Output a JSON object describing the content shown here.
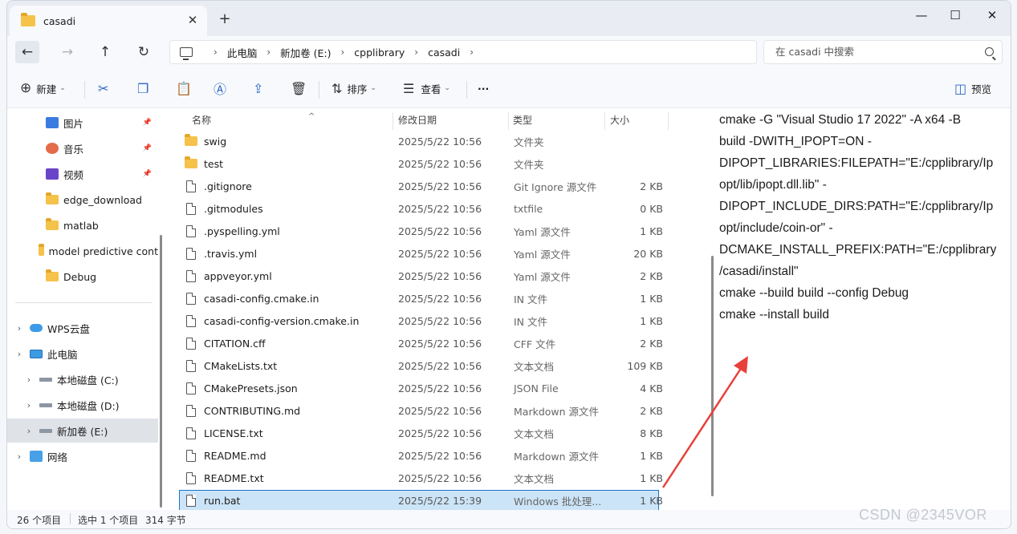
{
  "window": {
    "tab_title": "casadi",
    "new_tab": "+",
    "minimize": "—",
    "maximize": "☐",
    "close": "✕"
  },
  "nav": {
    "back": "←",
    "forward": "→",
    "up": "↑",
    "refresh": "↻"
  },
  "address": {
    "crumbs": [
      "此电脑",
      "新加卷 (E:)",
      "cpplibrary",
      "casadi"
    ],
    "separator": "›"
  },
  "search": {
    "placeholder": "在 casadi 中搜索"
  },
  "toolbar": {
    "new_label": "新建",
    "sort_label": "排序",
    "view_label": "查看",
    "more_label": "···",
    "preview_label": "预览"
  },
  "sidebar": {
    "items": [
      {
        "label": "图片",
        "icon": "pictures-icon",
        "pinned": true
      },
      {
        "label": "音乐",
        "icon": "music-icon",
        "pinned": true
      },
      {
        "label": "视频",
        "icon": "video-icon",
        "pinned": true
      },
      {
        "label": "edge_download",
        "icon": "folder-icon",
        "pinned": false
      },
      {
        "label": "matlab",
        "icon": "folder-icon",
        "pinned": false
      },
      {
        "label": "model predictive cont",
        "icon": "folder-icon",
        "pinned": false
      },
      {
        "label": "Debug",
        "icon": "folder-icon",
        "pinned": false
      },
      {
        "label": "WPS云盘",
        "icon": "cloud-icon",
        "pinned": false
      },
      {
        "label": "此电脑",
        "icon": "computer-icon",
        "pinned": false
      },
      {
        "label": "本地磁盘 (C:)",
        "icon": "drive-icon",
        "pinned": false
      },
      {
        "label": "本地磁盘 (D:)",
        "icon": "drive-icon",
        "pinned": false
      },
      {
        "label": "新加卷 (E:)",
        "icon": "drive-icon",
        "pinned": false
      },
      {
        "label": "网络",
        "icon": "network-icon",
        "pinned": false
      }
    ]
  },
  "columns": {
    "name": "名称",
    "date": "修改日期",
    "type": "类型",
    "size": "大小"
  },
  "files": [
    {
      "name": "swig",
      "date": "2025/5/22 10:56",
      "type": "文件夹",
      "size": "",
      "kind": "folder"
    },
    {
      "name": "test",
      "date": "2025/5/22 10:56",
      "type": "文件夹",
      "size": "",
      "kind": "folder"
    },
    {
      "name": ".gitignore",
      "date": "2025/5/22 10:56",
      "type": "Git Ignore 源文件",
      "size": "2 KB",
      "kind": "file"
    },
    {
      "name": ".gitmodules",
      "date": "2025/5/22 10:56",
      "type": "txtfile",
      "size": "0 KB",
      "kind": "file"
    },
    {
      "name": ".pyspelling.yml",
      "date": "2025/5/22 10:56",
      "type": "Yaml 源文件",
      "size": "1 KB",
      "kind": "file"
    },
    {
      "name": ".travis.yml",
      "date": "2025/5/22 10:56",
      "type": "Yaml 源文件",
      "size": "20 KB",
      "kind": "file"
    },
    {
      "name": "appveyor.yml",
      "date": "2025/5/22 10:56",
      "type": "Yaml 源文件",
      "size": "2 KB",
      "kind": "file"
    },
    {
      "name": "casadi-config.cmake.in",
      "date": "2025/5/22 10:56",
      "type": "IN 文件",
      "size": "1 KB",
      "kind": "file"
    },
    {
      "name": "casadi-config-version.cmake.in",
      "date": "2025/5/22 10:56",
      "type": "IN 文件",
      "size": "1 KB",
      "kind": "file"
    },
    {
      "name": "CITATION.cff",
      "date": "2025/5/22 10:56",
      "type": "CFF 文件",
      "size": "2 KB",
      "kind": "file"
    },
    {
      "name": "CMakeLists.txt",
      "date": "2025/5/22 10:56",
      "type": "文本文档",
      "size": "109 KB",
      "kind": "file"
    },
    {
      "name": "CMakePresets.json",
      "date": "2025/5/22 10:56",
      "type": "JSON File",
      "size": "4 KB",
      "kind": "file"
    },
    {
      "name": "CONTRIBUTING.md",
      "date": "2025/5/22 10:56",
      "type": "Markdown 源文件",
      "size": "2 KB",
      "kind": "file"
    },
    {
      "name": "LICENSE.txt",
      "date": "2025/5/22 10:56",
      "type": "文本文档",
      "size": "8 KB",
      "kind": "file"
    },
    {
      "name": "README.md",
      "date": "2025/5/22 10:56",
      "type": "Markdown 源文件",
      "size": "1 KB",
      "kind": "file"
    },
    {
      "name": "README.txt",
      "date": "2025/5/22 10:56",
      "type": "文本文档",
      "size": "1 KB",
      "kind": "file"
    },
    {
      "name": "run.bat",
      "date": "2025/5/22 15:39",
      "type": "Windows 批处理...",
      "size": "1 KB",
      "kind": "file",
      "selected": true
    }
  ],
  "preview_lines": [
    "cmake -G \"Visual Studio 17 2022\" -A x64 -B",
    "build -DWITH_IPOPT=ON -",
    "DIPOPT_LIBRARIES:FILEPATH=\"E:/cpplibrary/Ip",
    "opt/lib/ipopt.dll.lib\" -",
    "DIPOPT_INCLUDE_DIRS:PATH=\"E:/cpplibrary/Ip",
    "opt/include/coin-or\"  -",
    "DCMAKE_INSTALL_PREFIX:PATH=\"E:/cpplibrary",
    "/casadi/install\"",
    "cmake --build build --config Debug",
    "cmake --install build"
  ],
  "status": {
    "count": "26 个项目",
    "selected": "选中 1 个项目",
    "size": "314 字节"
  },
  "watermark": "CSDN @2345VOR",
  "colors": {
    "accent": "#1a74c5",
    "selection_bg": "#cce4f7",
    "folder": "#f5c24a",
    "annotation_arrow": "#e8413a"
  }
}
